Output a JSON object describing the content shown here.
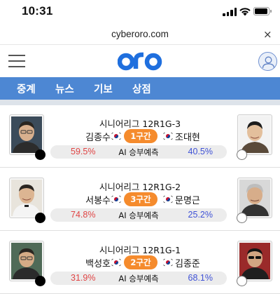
{
  "status_bar": {
    "time": "10:31",
    "icons": [
      "cellular-signal-icon",
      "wifi-icon",
      "battery-icon"
    ]
  },
  "browser": {
    "url": "cyberoro.com",
    "close_label": "×"
  },
  "app_header": {
    "logo_text": "oro",
    "icons": [
      "hamburger-menu-icon",
      "user-profile-icon"
    ],
    "colors": {
      "brand_blue": "#1f6fde",
      "nav_blue": "#4d87d3"
    }
  },
  "nav": {
    "tabs": [
      {
        "label": "중계"
      },
      {
        "label": "뉴스"
      },
      {
        "label": "기보"
      },
      {
        "label": "상점"
      }
    ]
  },
  "games": [
    {
      "league": "시니어리그 12R1G-3",
      "black_player": "김종수",
      "white_player": "조대현",
      "round_badge": "1구간",
      "prediction_label": "AI 승부예측",
      "black_win_pct": "59.5%",
      "white_win_pct": "40.5%"
    },
    {
      "league": "시니어리그 12R1G-2",
      "black_player": "서봉수",
      "white_player": "문명근",
      "round_badge": "3구간",
      "prediction_label": "AI 승부예측",
      "black_win_pct": "74.8%",
      "white_win_pct": "25.2%"
    },
    {
      "league": "시니어리그 12R1G-1",
      "black_player": "백성호",
      "white_player": "김종준",
      "round_badge": "2구간",
      "prediction_label": "AI 승부예측",
      "black_win_pct": "31.9%",
      "white_win_pct": "68.1%"
    }
  ],
  "colors": {
    "badge_orange": "#f58b2d",
    "black_pct_red": "#e04545",
    "white_pct_blue": "#3f52d6"
  }
}
